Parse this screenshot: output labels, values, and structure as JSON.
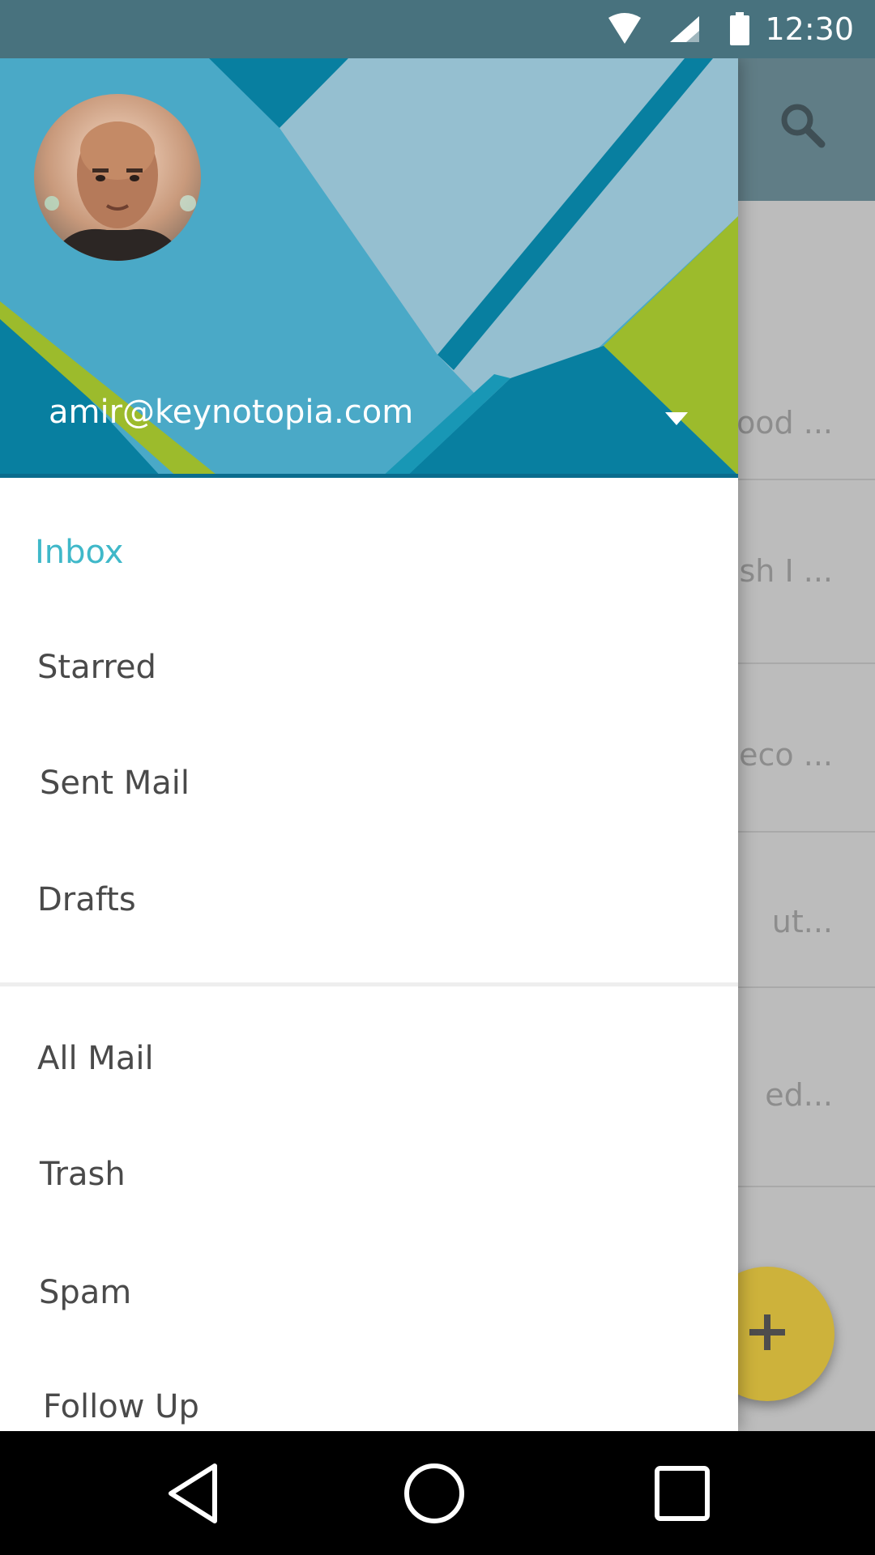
{
  "status_bar": {
    "time": "12:30",
    "icons": [
      "wifi-icon",
      "cell-signal-icon",
      "battery-icon"
    ]
  },
  "background_app": {
    "search_icon": "search-icon",
    "list_snippets": [
      "ood ...",
      "ish I ...",
      "eco ...",
      "ut...",
      "ed..."
    ],
    "fab_icon": "plus-icon"
  },
  "drawer": {
    "account": {
      "email": "amir@keynotopia.com",
      "dropdown_icon": "arrow-drop-down-icon"
    },
    "primary_items": [
      {
        "label": "Inbox",
        "active": true
      },
      {
        "label": "Starred"
      },
      {
        "label": "Sent Mail"
      },
      {
        "label": "Drafts"
      }
    ],
    "secondary_items": [
      {
        "label": "All Mail"
      },
      {
        "label": "Trash"
      },
      {
        "label": "Spam"
      },
      {
        "label": "Follow Up"
      }
    ]
  },
  "colors": {
    "status_bar": "#48727e",
    "accent": "#3fb8c9",
    "fab": "#cdb23b",
    "header_blue": "#4aa9c7",
    "header_dark_teal": "#087fa0",
    "header_light": "#95bfd0",
    "header_green": "#9cbb2c"
  },
  "nav_bar": {
    "icons": [
      "back-icon",
      "home-icon",
      "recents-icon"
    ]
  }
}
